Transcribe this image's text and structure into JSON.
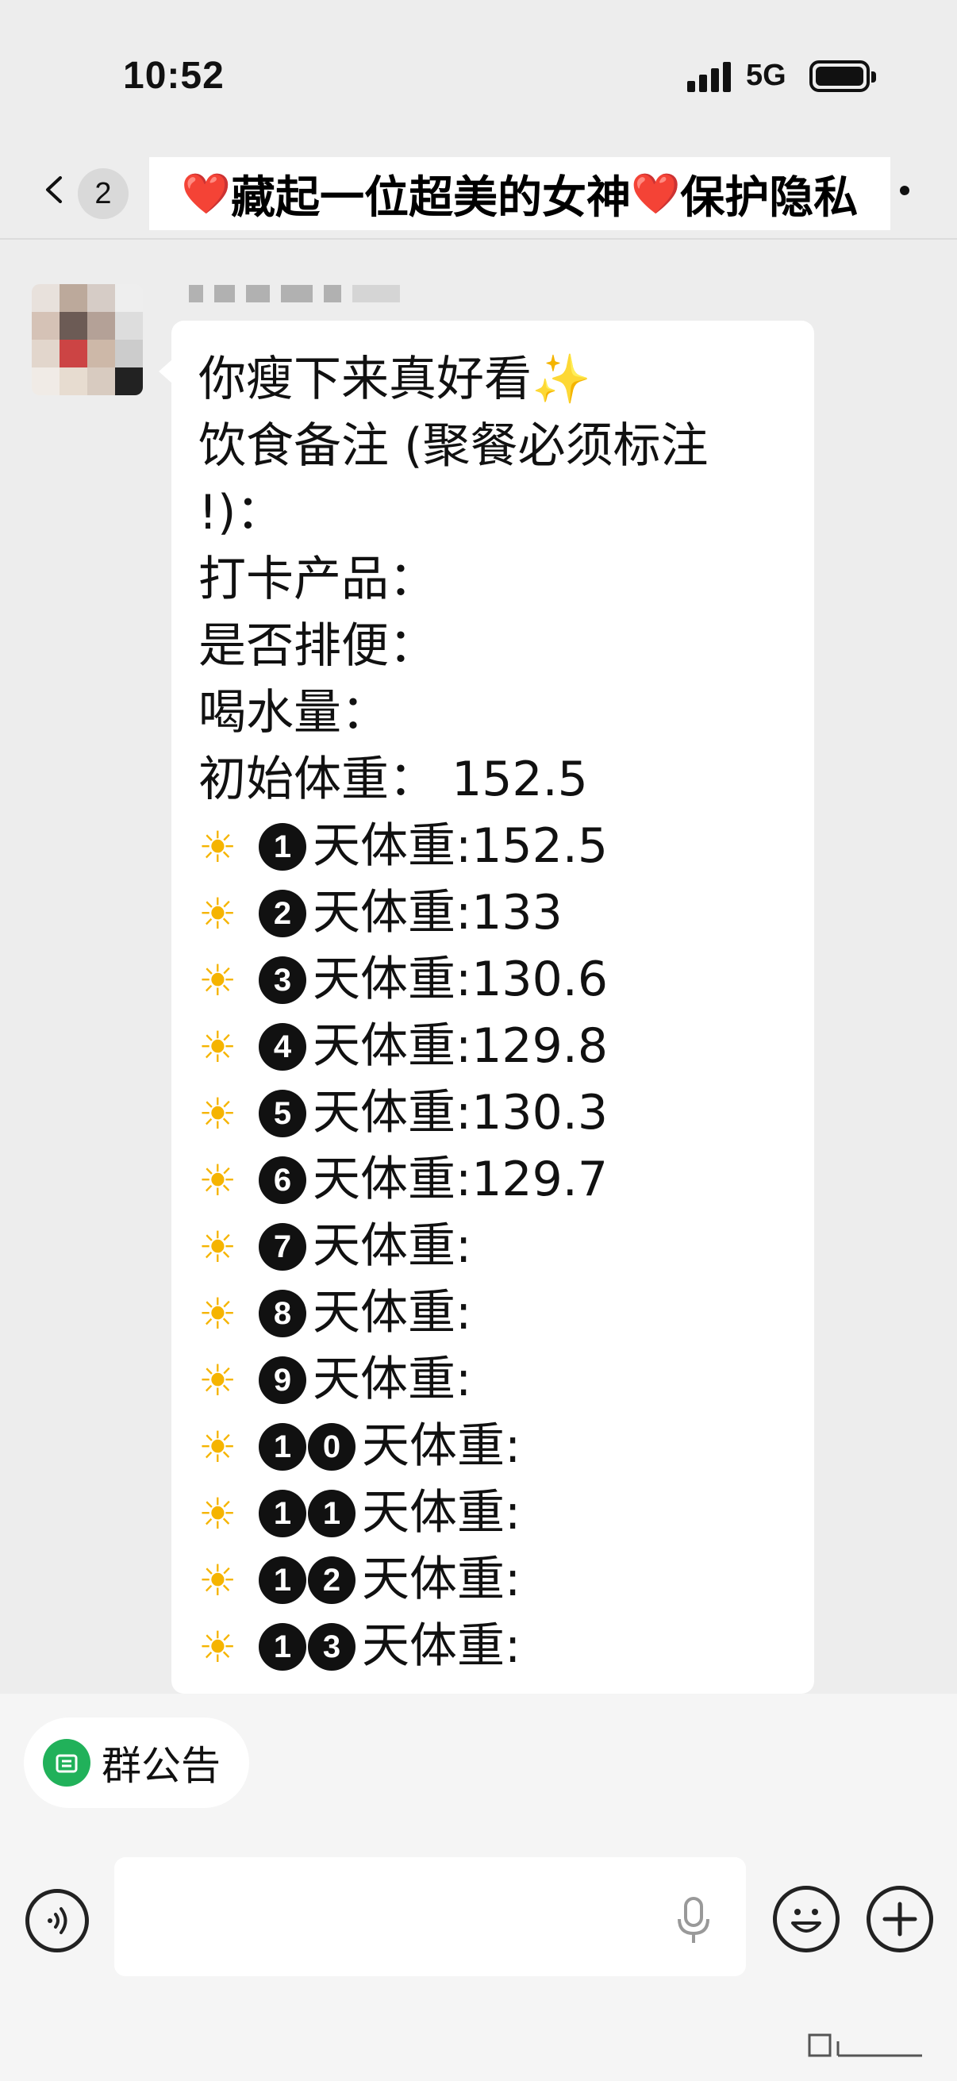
{
  "status_bar": {
    "time": "10:52",
    "network": "5G",
    "icons": [
      "signal-bars-icon",
      "battery-icon"
    ]
  },
  "nav": {
    "back_icon": "chevron-left-icon",
    "unread_count": "2",
    "title_heart": "❤️",
    "title_part1": "藏起一位超美的女神",
    "title_part2": "保护隐私",
    "more_icon": "more-dot-icon"
  },
  "message": {
    "sender_avatar": "pixelated-avatar",
    "sender_name_redacted": true,
    "lines": [
      {
        "text": "你瘦下来真好看",
        "sparkle": "✨"
      },
      {
        "text": "饮食备注 (聚餐必须标注"
      },
      {
        "text": "!)："
      },
      {
        "text": "打卡产品："
      },
      {
        "text": "是否排便："
      },
      {
        "text": "喝水量："
      },
      {
        "text": "初始体重： 152.5"
      }
    ],
    "sun_icon": "☀",
    "day_label": "天体重:",
    "days": [
      {
        "n": [
          "1"
        ],
        "weight": "152.5"
      },
      {
        "n": [
          "2"
        ],
        "weight": "133"
      },
      {
        "n": [
          "3"
        ],
        "weight": "130.6"
      },
      {
        "n": [
          "4"
        ],
        "weight": "129.8"
      },
      {
        "n": [
          "5"
        ],
        "weight": "130.3"
      },
      {
        "n": [
          "6"
        ],
        "weight": "129.7"
      },
      {
        "n": [
          "7"
        ],
        "weight": ""
      },
      {
        "n": [
          "8"
        ],
        "weight": ""
      },
      {
        "n": [
          "9"
        ],
        "weight": ""
      },
      {
        "n": [
          "1",
          "0"
        ],
        "weight": ""
      },
      {
        "n": [
          "1",
          "1"
        ],
        "weight": ""
      },
      {
        "n": [
          "1",
          "2"
        ],
        "weight": ""
      },
      {
        "n": [
          "1",
          "3"
        ],
        "weight": ""
      }
    ]
  },
  "bottom": {
    "notice_label": "群公告",
    "notice_icon": "notice-icon",
    "input_placeholder": "",
    "voice_icon": "voice-icon",
    "mic_icon": "microphone-icon",
    "emoji_icon": "emoji-icon",
    "plus_icon": "plus-icon"
  },
  "colors": {
    "background": "#ededed",
    "bubble": "#ffffff",
    "heart": "#e02020",
    "notice_green": "#21b15a",
    "sun": "#f5b400"
  }
}
